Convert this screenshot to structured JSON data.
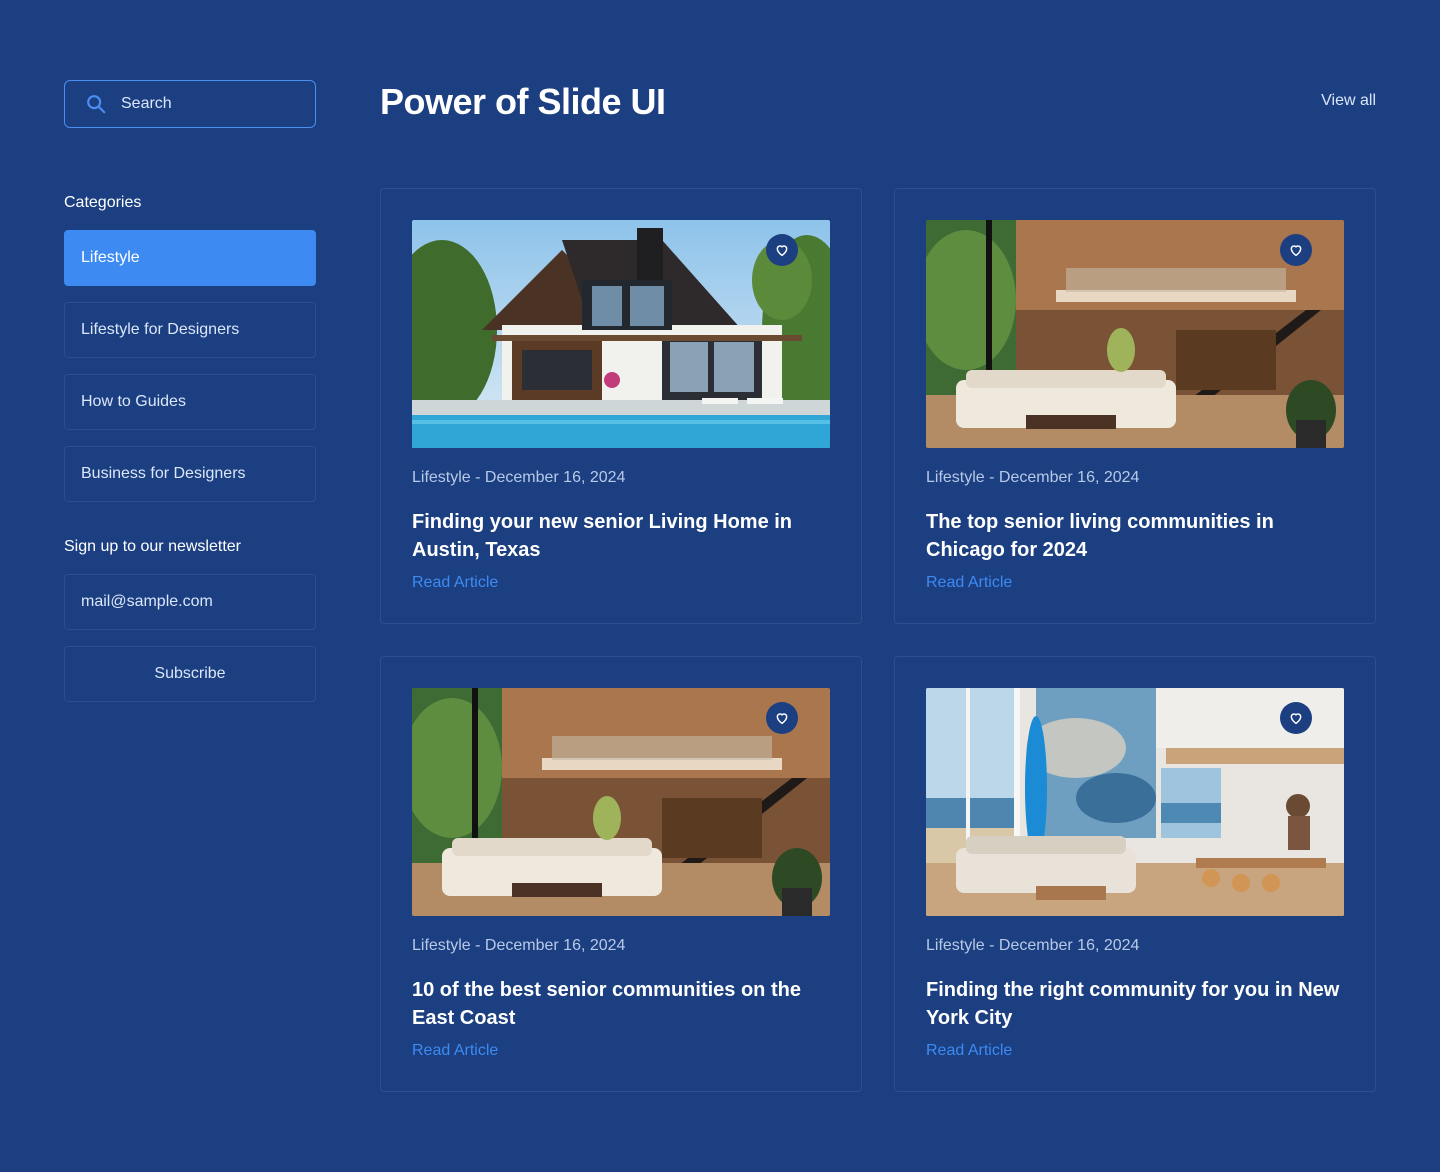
{
  "search": {
    "placeholder": "Search",
    "icon": "search-icon"
  },
  "sidebar": {
    "categories_label": "Categories",
    "categories": [
      {
        "label": "Lifestyle",
        "active": true
      },
      {
        "label": "Lifestyle for Designers",
        "active": false
      },
      {
        "label": "How to Guides",
        "active": false
      },
      {
        "label": "Business for Designers",
        "active": false
      }
    ],
    "newsletter_label": "Sign up to our newsletter",
    "email_placeholder": "mail@sample.com",
    "subscribe_label": "Subscribe"
  },
  "main": {
    "title": "Power of Slide UI",
    "view_all": "View all",
    "cards": [
      {
        "meta": "Lifestyle - December 16, 2024",
        "title": "Finding your new senior Living Home in Austin, Texas",
        "link": "Read Article",
        "image": "modern-house-pool"
      },
      {
        "meta": "Lifestyle - December 16, 2024",
        "title": "The top senior living communities in Chicago for 2024",
        "link": "Read Article",
        "image": "wooden-loft-interior"
      },
      {
        "meta": "Lifestyle - December 16, 2024",
        "title": "10 of the best senior communities on the East Coast",
        "link": "Read Article",
        "image": "wooden-loft-interior"
      },
      {
        "meta": "Lifestyle - December 16, 2024",
        "title": "Finding the right community for you in New York City",
        "link": "Read Article",
        "image": "beach-loft-interior"
      }
    ]
  },
  "colors": {
    "background": "#1b3f80",
    "accent": "#3d8bf2",
    "border": "#2b4f8f"
  }
}
